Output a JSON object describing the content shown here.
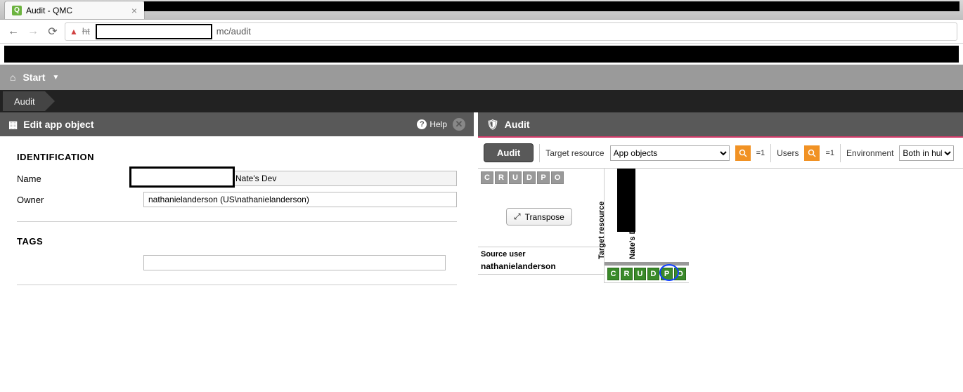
{
  "browser": {
    "tab_title": "Audit - QMC",
    "url_suffix": "mc/audit"
  },
  "header": {
    "start": "Start",
    "breadcrumb": "Audit"
  },
  "left_panel": {
    "title": "Edit app object",
    "help": "Help",
    "identification_section": "IDENTIFICATION",
    "name_label": "Name",
    "name_value_suffix": "Nate's Dev",
    "owner_label": "Owner",
    "owner_value": "nathanielanderson (US\\nathanielanderson)",
    "tags_section": "TAGS"
  },
  "right_panel": {
    "title": "Audit",
    "audit_button": "Audit",
    "target_resource_label": "Target resource",
    "target_resource_value": "App objects",
    "users_label": "Users",
    "environment_label": "Environment",
    "environment_value": "Both in hub",
    "count_eq1": "=1",
    "transpose": "Transpose",
    "target_resource_header": "Target resource",
    "column_value": "Nate's Dev",
    "source_user_label": "Source user",
    "source_user_value": "nathanielanderson",
    "crud_header": [
      "C",
      "R",
      "U",
      "D",
      "P",
      "O"
    ],
    "crud_result": [
      "C",
      "R",
      "U",
      "D",
      "P",
      "O"
    ]
  }
}
